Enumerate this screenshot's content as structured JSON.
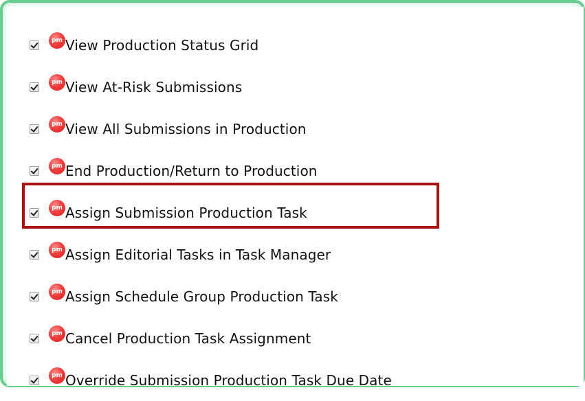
{
  "permissions": [
    {
      "label": "View Production Status Grid",
      "checked": true,
      "badge": "pm",
      "highlighted": false
    },
    {
      "label": "View At-Risk Submissions",
      "checked": true,
      "badge": "pm",
      "highlighted": false
    },
    {
      "label": "View All Submissions in Production",
      "checked": true,
      "badge": "pm",
      "highlighted": false
    },
    {
      "label": "End Production/Return to Production",
      "checked": true,
      "badge": "pm",
      "highlighted": false
    },
    {
      "label": "Assign Submission Production Task",
      "checked": true,
      "badge": "pm",
      "highlighted": true
    },
    {
      "label": "Assign Editorial Tasks in Task Manager",
      "checked": true,
      "badge": "pm",
      "highlighted": false
    },
    {
      "label": "Assign Schedule Group Production Task",
      "checked": true,
      "badge": "pm",
      "highlighted": false
    },
    {
      "label": "Cancel Production Task Assignment",
      "checked": true,
      "badge": "pm",
      "highlighted": false
    },
    {
      "label": "Override Submission Production Task Due Date",
      "checked": true,
      "badge": "pm",
      "highlighted": false
    }
  ],
  "colors": {
    "frame_border": "#66cd8e",
    "highlight_border": "#a81212",
    "badge_red": "#e8302f",
    "text": "#111111"
  },
  "icons": {
    "badge": "pm-badge-icon",
    "checkbox": "checked-checkbox"
  }
}
